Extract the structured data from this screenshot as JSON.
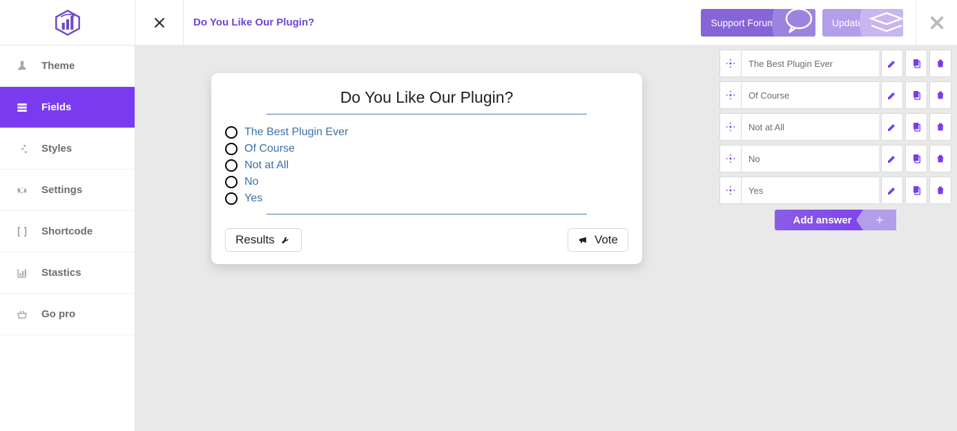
{
  "header": {
    "title": "Do You Like Our Plugin?",
    "support_label": "Support Forum",
    "update_label": "Update"
  },
  "sidebar": {
    "items": [
      {
        "label": "Theme"
      },
      {
        "label": "Fields"
      },
      {
        "label": "Styles"
      },
      {
        "label": "Settings"
      },
      {
        "label": "Shortcode"
      },
      {
        "label": "Stastics"
      },
      {
        "label": "Go pro"
      }
    ],
    "active_index": 1
  },
  "poll": {
    "title": "Do You Like Our Plugin?",
    "options": [
      {
        "label": "The Best Plugin Ever"
      },
      {
        "label": "Of Course"
      },
      {
        "label": "Not at All"
      },
      {
        "label": "No"
      },
      {
        "label": "Yes"
      }
    ],
    "results_label": "Results",
    "vote_label": "Vote"
  },
  "answers_panel": {
    "items": [
      {
        "label": "The Best Plugin Ever"
      },
      {
        "label": "Of Course"
      },
      {
        "label": "Not at All"
      },
      {
        "label": "No"
      },
      {
        "label": "Yes"
      }
    ],
    "add_label": "Add answer"
  }
}
